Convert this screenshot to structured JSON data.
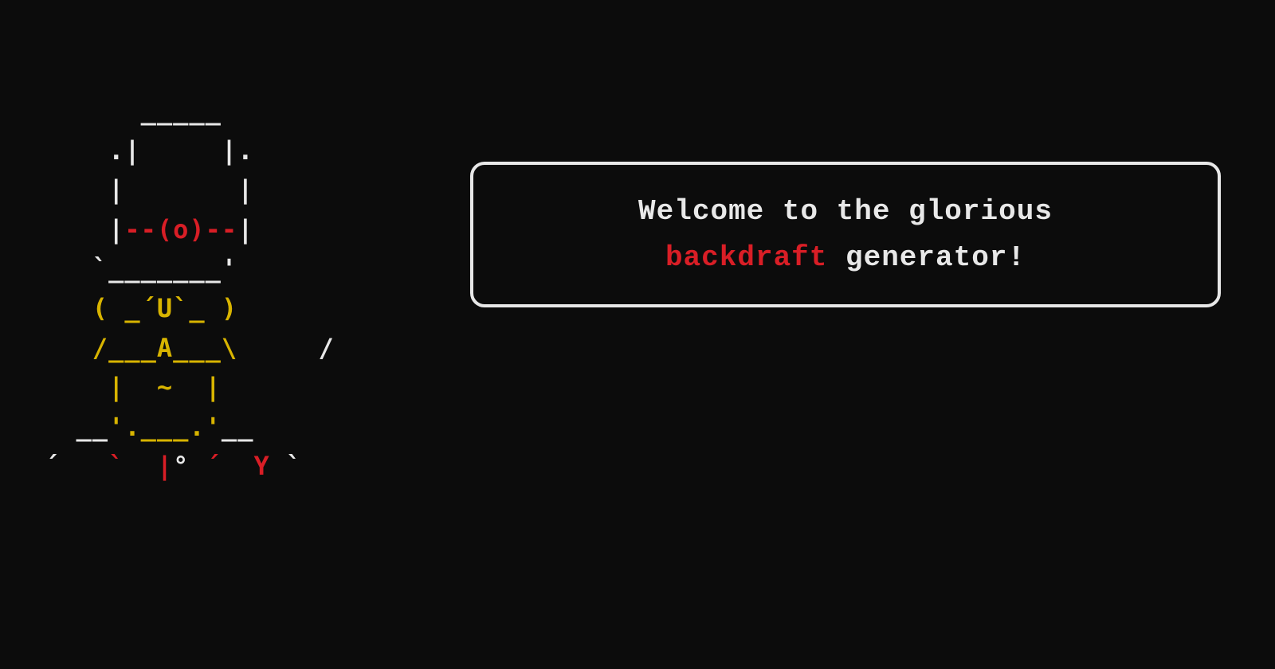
{
  "ascii": {
    "line1": {
      "w1": "      _____"
    },
    "line2": {
      "w1": "    .|     |."
    },
    "line3": {
      "w1": "    |       |"
    },
    "line4": {
      "w1": "    |",
      "r1": "--(o)--",
      "w2": "|"
    },
    "line5": {
      "w1": "   `_______'"
    },
    "line6": {
      "y1": "   ( _´U`_ )"
    },
    "line7": {
      "y1": "   /___A___\\",
      "w1": "     /"
    },
    "line8": {
      "y1": "    |  ~  |"
    },
    "line9": {
      "w1": "  __",
      "y1": "'.___.'",
      "w2": "__"
    },
    "line10": {
      "w1": "´   ",
      "r1": "`  |",
      "w2": "° ",
      "r2": "´  Y",
      "w3": " `"
    }
  },
  "speech": {
    "prefix": "Welcome to the glorious",
    "highlight": "backdraft",
    "suffix": " generator!"
  },
  "tail": "/"
}
